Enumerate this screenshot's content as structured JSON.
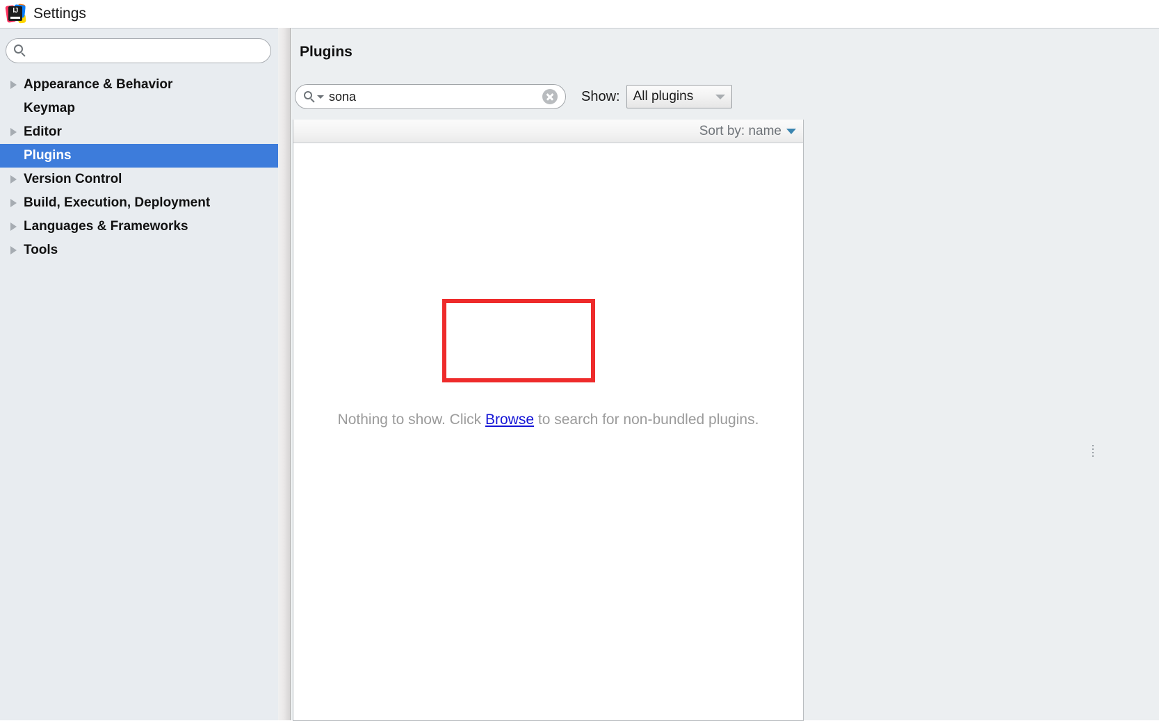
{
  "window": {
    "title": "Settings",
    "logo_icon": "intellij-idea-logo",
    "logo_text": "IJ"
  },
  "sidebar": {
    "search": {
      "value": "",
      "placeholder": "",
      "icon": "search-icon"
    },
    "items": [
      {
        "label": "Appearance & Behavior",
        "expandable": true,
        "selected": false
      },
      {
        "label": "Keymap",
        "expandable": false,
        "selected": false
      },
      {
        "label": "Editor",
        "expandable": true,
        "selected": false
      },
      {
        "label": "Plugins",
        "expandable": false,
        "selected": true
      },
      {
        "label": "Version Control",
        "expandable": true,
        "selected": false
      },
      {
        "label": "Build, Execution, Deployment",
        "expandable": true,
        "selected": false
      },
      {
        "label": "Languages & Frameworks",
        "expandable": true,
        "selected": false
      },
      {
        "label": "Tools",
        "expandable": true,
        "selected": false
      }
    ]
  },
  "main": {
    "page_title": "Plugins",
    "plugin_search": {
      "value": "sona",
      "placeholder": "",
      "icon": "search-icon",
      "dropdown_icon": "chevron-down-icon",
      "clear_icon": "clear-circle-icon"
    },
    "show_filter": {
      "label": "Show:",
      "selected": "All plugins",
      "caret_icon": "chevron-down-icon"
    },
    "list": {
      "sort_label": "Sort by: name",
      "sort_caret_icon": "chevron-down-icon",
      "empty_state": {
        "prefix": "Nothing to show. Click ",
        "link": "Browse",
        "suffix": " to search for non-bundled plugins."
      }
    }
  },
  "annotation": {
    "shape": "rectangle",
    "color": "#ee2b2b"
  },
  "colors": {
    "selection": "#3d7cdb",
    "sidebar_bg": "#e8ecf0",
    "panel_bg": "#eceff1",
    "link": "#1414d6",
    "annotation": "#ee2b2b"
  }
}
